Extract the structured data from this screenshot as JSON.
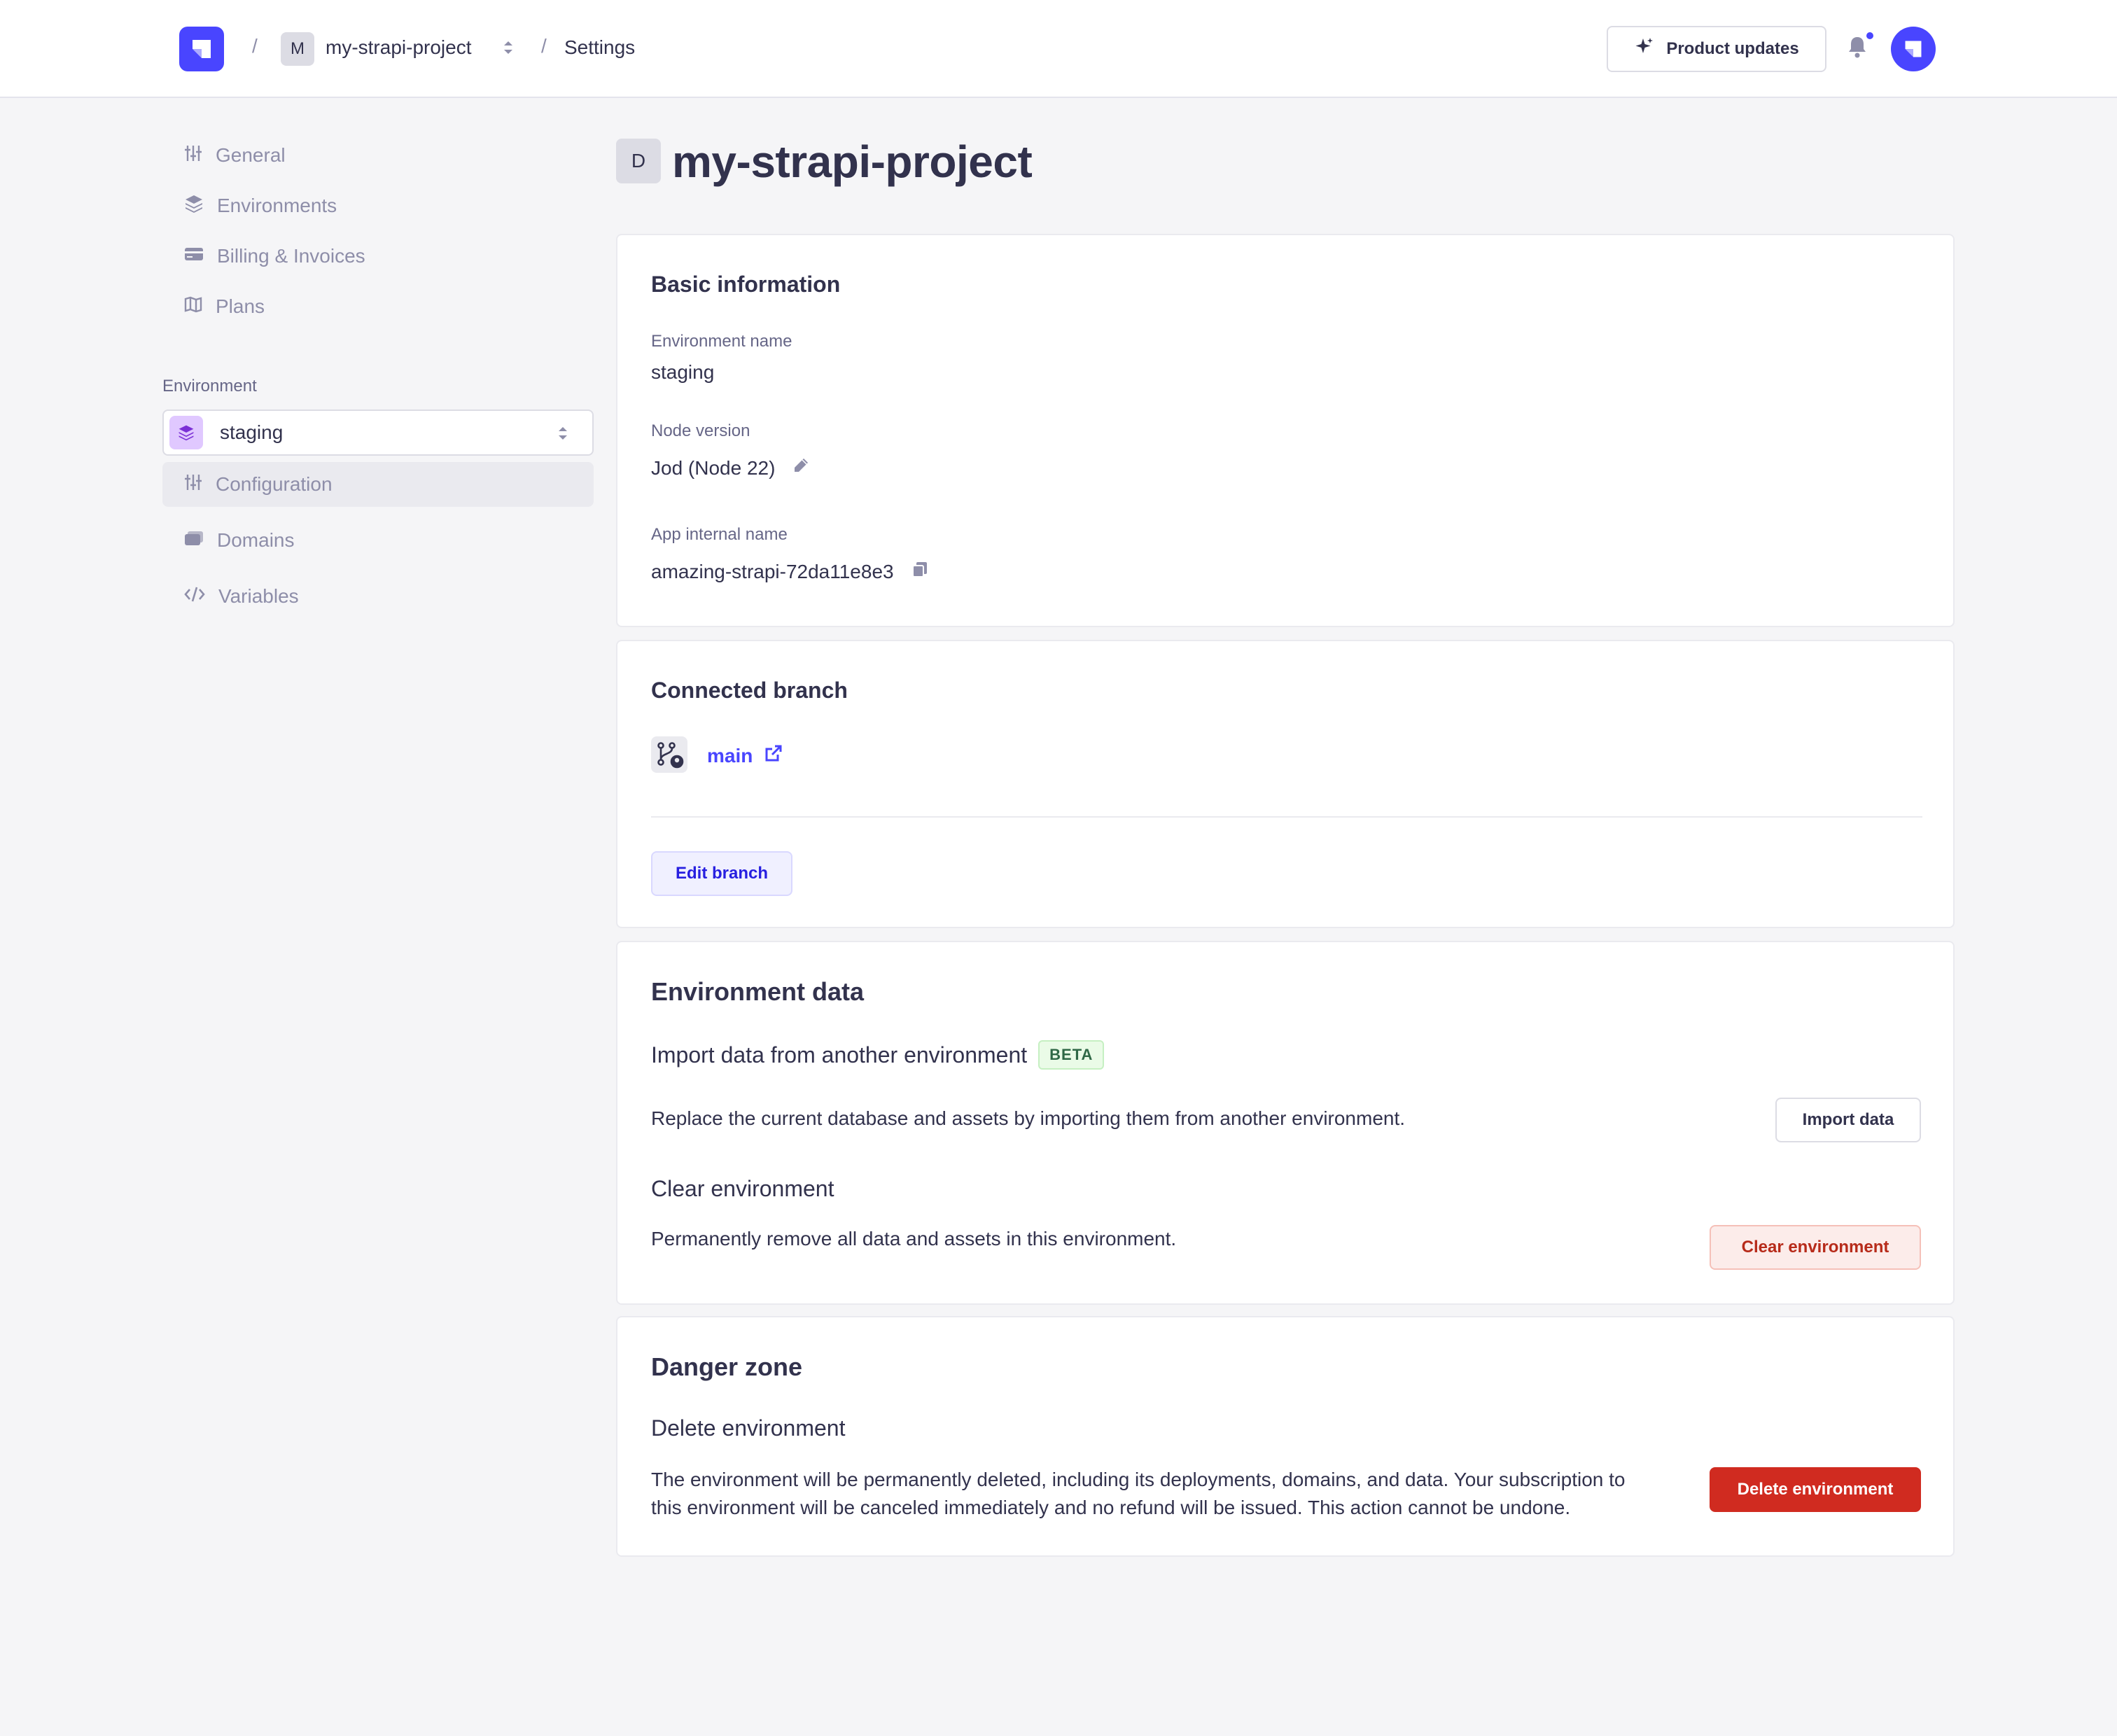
{
  "header": {
    "project_chip": "M",
    "project_name": "my-strapi-project",
    "crumb_separator": "/",
    "current_page": "Settings",
    "product_updates_label": "Product updates"
  },
  "sidebar": {
    "items": [
      {
        "label": "General",
        "icon": "sliders-icon"
      },
      {
        "label": "Environments",
        "icon": "layers-icon"
      },
      {
        "label": "Billing & Invoices",
        "icon": "credit-card-icon"
      },
      {
        "label": "Plans",
        "icon": "map-icon"
      }
    ],
    "environment_label": "Environment",
    "environment_value": "staging",
    "env_items": [
      {
        "label": "Configuration",
        "icon": "sliders-icon",
        "active": true
      },
      {
        "label": "Domains",
        "icon": "domains-icon"
      },
      {
        "label": "Variables",
        "icon": "code-icon"
      }
    ]
  },
  "page": {
    "title_chip": "D",
    "title": "my-strapi-project"
  },
  "basic_info": {
    "title": "Basic information",
    "env_name_label": "Environment name",
    "env_name_value": "staging",
    "node_label": "Node version",
    "node_value": "Jod (Node 22)",
    "app_label": "App internal name",
    "app_value": "amazing-strapi-72da11e8e3"
  },
  "branch": {
    "title": "Connected branch",
    "name": "main",
    "edit_label": "Edit branch"
  },
  "env_data": {
    "title": "Environment data",
    "import_heading": "Import data from another environment",
    "beta_label": "BETA",
    "import_text": "Replace the current database and assets by importing them from another environment.",
    "import_button": "Import data",
    "clear_heading": "Clear environment",
    "clear_text": "Permanently remove all data and assets in this environment.",
    "clear_button": "Clear environment"
  },
  "danger": {
    "title": "Danger zone",
    "delete_heading": "Delete environment",
    "delete_text_line1": "The environment will be permanently deleted, including its deployments, domains, and data. Your subscription to",
    "delete_text_line2": "this environment will be canceled immediately and no refund will be issued. This action cannot be undone.",
    "delete_button": "Delete environment"
  },
  "colors": {
    "primary": "#4945ff",
    "danger": "#d02b20",
    "background": "#f5f5f7",
    "text": "#32324d",
    "muted": "#8e8ea9"
  }
}
